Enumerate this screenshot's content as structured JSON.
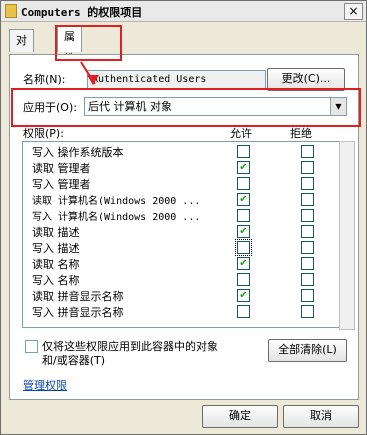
{
  "window": {
    "title": "Computers 的权限项目",
    "close": "×"
  },
  "tabs": [
    {
      "label": "对象"
    },
    {
      "label": "属性"
    }
  ],
  "name_row": {
    "label": "名称(N):",
    "value": "Authenticated Users",
    "change_button": "更改(C)..."
  },
  "apply_row": {
    "label": "应用于(O):",
    "selected": "后代 计算机 对象"
  },
  "permissions": {
    "header_label": "权限(P):",
    "allow_header": "允许",
    "deny_header": "拒绝",
    "rows": [
      {
        "label": "写入 操作系统版本",
        "allow": false,
        "deny": false
      },
      {
        "label": "读取 管理者",
        "allow": true,
        "deny": false
      },
      {
        "label": "写入 管理者",
        "allow": false,
        "deny": false
      },
      {
        "label": "读取 计算机名(Windows 2000 ...",
        "allow": true,
        "deny": false
      },
      {
        "label": "写入 计算机名(Windows 2000 ...",
        "allow": false,
        "deny": false
      },
      {
        "label": "读取 描述",
        "allow": true,
        "deny": false
      },
      {
        "label": "写入 描述",
        "allow": false,
        "deny": false
      },
      {
        "label": "读取 名称",
        "allow": true,
        "deny": false
      },
      {
        "label": "写入 名称",
        "allow": false,
        "deny": false
      },
      {
        "label": "读取 拼音显示名称",
        "allow": true,
        "deny": false
      },
      {
        "label": "写入 拼音显示名称",
        "allow": false,
        "deny": false
      }
    ]
  },
  "options": {
    "only_apply_label_line1": "仅将这些权限应用到此容器中的对象",
    "only_apply_label_line2": "和/或容器(T)",
    "clear_all_button": "全部清除(L)"
  },
  "manage_link": "管理权限",
  "footer": {
    "ok": "确定",
    "cancel": "取消"
  },
  "colors": {
    "highlight": "#e02020",
    "check": "#21a121"
  }
}
